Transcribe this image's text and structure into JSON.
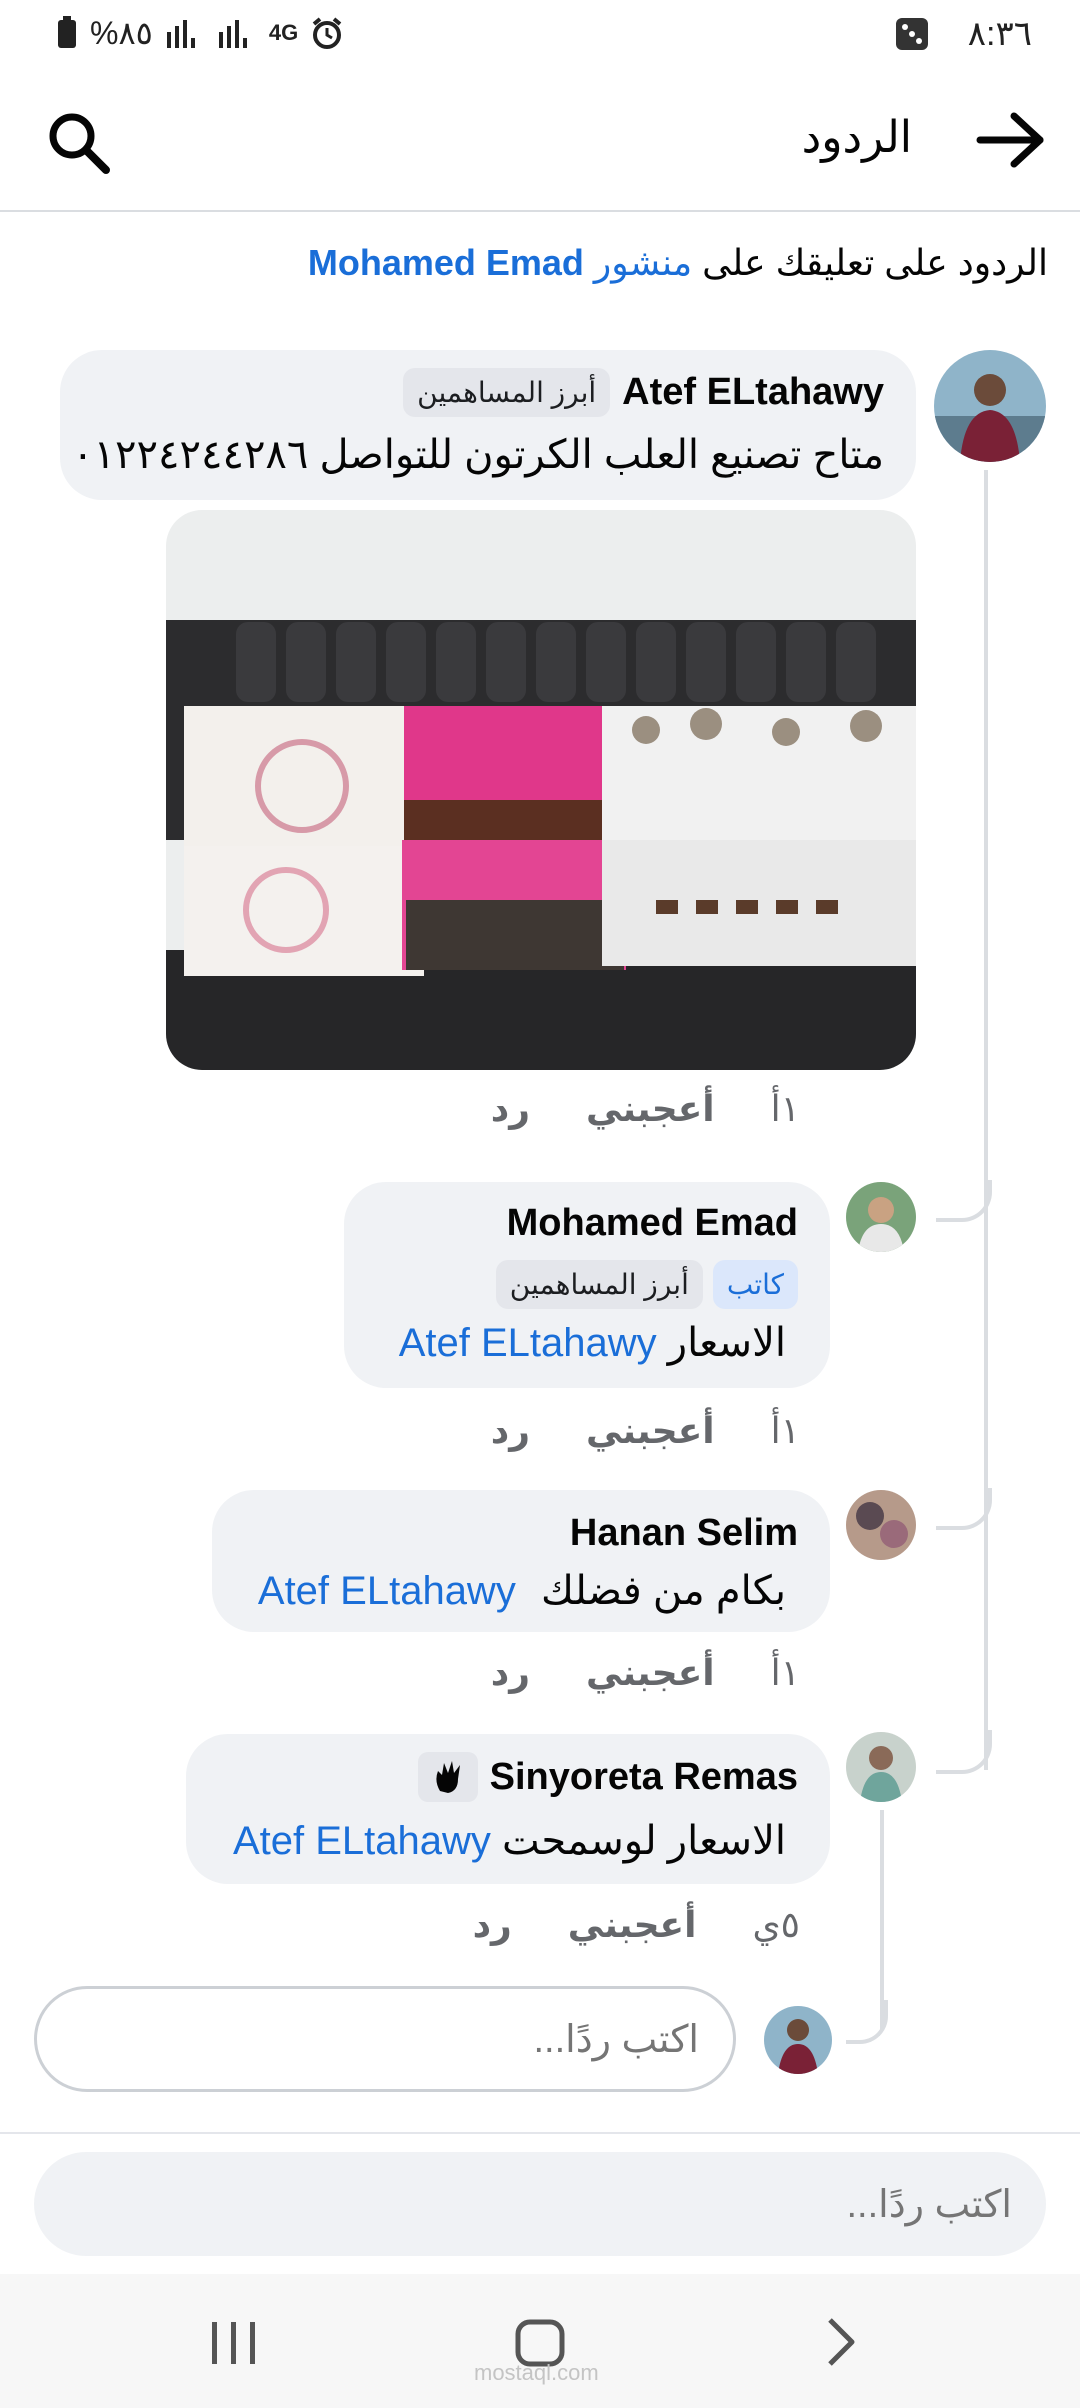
{
  "status_bar": {
    "time": "٨:٣٦",
    "battery": "%٨٥",
    "network": "4G"
  },
  "header": {
    "title": "الردود"
  },
  "context": {
    "prefix": "الردود على تعليقك على",
    "post_word": "منشور",
    "post_author": "Mohamed Emad"
  },
  "comments": [
    {
      "name": "Atef ELtahawy",
      "badge": "أبرز المساهمين",
      "text": "متاح تصنيع العلب الكرتون للتواصل  ٠١٢٢٤٢٤٤٢٨٦",
      "time": "١أ",
      "like": "أعجبني",
      "reply": "رد"
    }
  ],
  "replies": [
    {
      "name": "Mohamed Emad",
      "author_badge": "كاتب",
      "badge": "أبرز المساهمين",
      "text": "الاسعار",
      "mention": "Atef ELtahawy",
      "time": "١أ",
      "like": "أعجبني",
      "reply": "رد"
    },
    {
      "name": "Hanan Selim",
      "text": "بكام من فضلك",
      "mention": "Atef ELtahawy",
      "time": "١أ",
      "like": "أعجبني",
      "reply": "رد"
    },
    {
      "name": "Sinyoreta Remas",
      "text": "الاسعار لوسمحت",
      "mention": "Atef ELtahawy",
      "time": "٥ي",
      "like": "أعجبني",
      "reply": "رد"
    }
  ],
  "reply_input": {
    "placeholder": "اكتب ردًا..."
  },
  "bottom_input": {
    "placeholder": "اكتب ردًا..."
  },
  "nav": {
    "recent_icon": "recent-apps-icon",
    "home_icon": "home-icon",
    "back_icon": "back-icon"
  },
  "watermark": "mostaql.com",
  "colors": {
    "link": "#1a6ed8",
    "bubble": "#f0f2f5",
    "secondary": "#65676b"
  }
}
